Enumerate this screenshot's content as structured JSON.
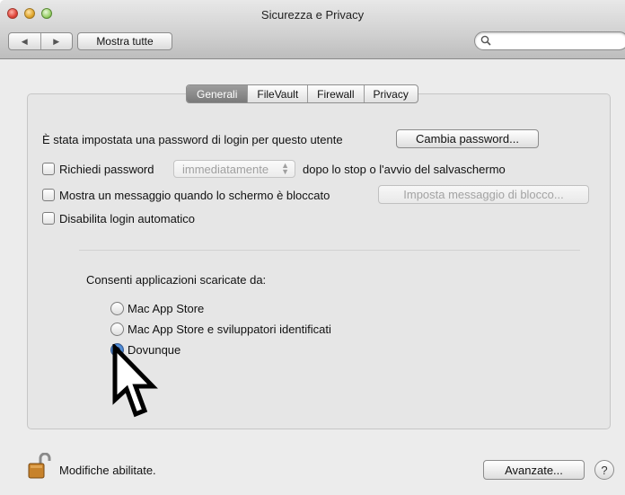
{
  "window": {
    "title": "Sicurezza e Privacy"
  },
  "toolbar": {
    "back_icon": "◀",
    "forward_icon": "▶",
    "show_all_label": "Mostra tutte",
    "search_placeholder": ""
  },
  "tabs": [
    {
      "label": "Generali",
      "active": true
    },
    {
      "label": "FileVault",
      "active": false
    },
    {
      "label": "Firewall",
      "active": false
    },
    {
      "label": "Privacy",
      "active": false
    }
  ],
  "general": {
    "password_text": "È stata impostata una password di login per questo utente",
    "change_password_label": "Cambia password...",
    "require_password": {
      "checked": false,
      "label": "Richiedi password",
      "select_value": "immediatamente",
      "suffix": "dopo lo stop o l'avvio del salvaschermo"
    },
    "show_message": {
      "checked": false,
      "label": "Mostra un messaggio quando lo schermo è bloccato",
      "button_label": "Imposta messaggio di blocco..."
    },
    "disable_autologin": {
      "checked": false,
      "label": "Disabilita login automatico"
    }
  },
  "downloads": {
    "heading": "Consenti applicazioni scaricate da:",
    "options": [
      {
        "label": "Mac App Store",
        "selected": false
      },
      {
        "label": "Mac App Store e sviluppatori identificati",
        "selected": false
      },
      {
        "label": "Dovunque",
        "selected": true
      }
    ]
  },
  "footer": {
    "lock_status": "Modifiche abilitate.",
    "advanced_label": "Avanzate...",
    "help_label": "?"
  },
  "colors": {
    "accent": "#2d6bc2",
    "active_tab": "#8a8a8a"
  }
}
